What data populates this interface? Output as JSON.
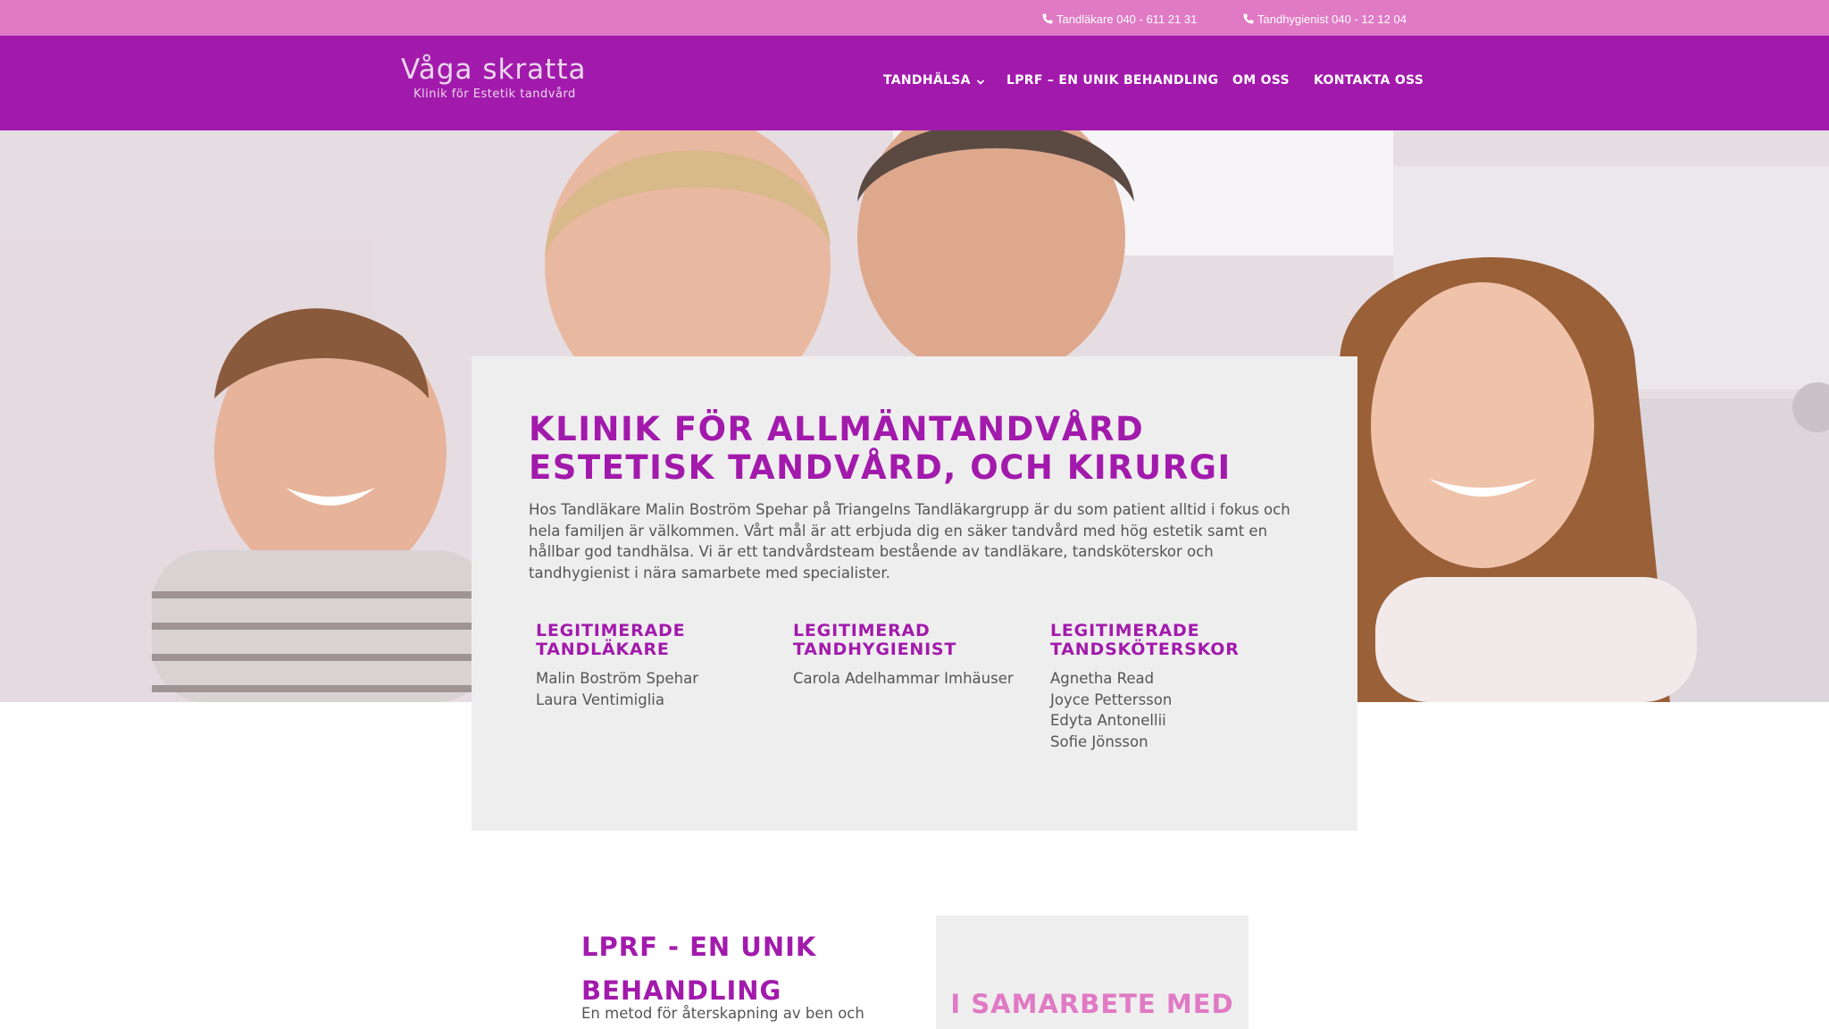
{
  "topbar": {
    "contacts": [
      {
        "icon": "phone-icon",
        "label": "Tandläkare 040 - 611 21 31"
      },
      {
        "icon": "phone-icon",
        "label": "Tandhygienist 040 - 12 12 04"
      }
    ],
    "background": "#e07ac4"
  },
  "header": {
    "background": "#a21aac",
    "logo": {
      "main": "Våga skratta",
      "sub": "Klinik för Estetik tandvård"
    },
    "nav": [
      {
        "label": "TANDHÄLSA",
        "icon": "chevron-down-icon"
      },
      {
        "label": "LPRF – EN UNIK BEHANDLING"
      },
      {
        "label": "OM OSS"
      },
      {
        "label": "KONTAKTA OSS"
      }
    ]
  },
  "card": {
    "title": "KLINIK FÖR ALLMÄNTANDVÅRD ESTETISK TANDVÅRD, OCH KIRURGI",
    "intro": "Hos Tandläkare Malin Boström Spehar på Triangelns Tandläkargrupp är du som patient alltid i fokus och hela familjen är välkommen. Vårt mål är att erbjuda dig en säker tandvård med hög estetik samt en hållbar god tandhälsa. Vi är ett tandvårdsteam bestående av tandläkare, tandsköterskor och tandhygienist i nära samarbete med specialister.",
    "staff": [
      {
        "heading": "LEGITIMERADE TANDLÄKARE",
        "names": [
          "Malin Boström Spehar",
          "Laura Ventimiglia"
        ]
      },
      {
        "heading": "LEGITIMERAD TANDHYGIENIST",
        "names": [
          "Carola Adelhammar Imhäuser"
        ]
      },
      {
        "heading": "LEGITIMERADE TANDSKÖTERSKOR",
        "names": [
          "Agnetha Read",
          "Joyce Pettersson",
          "Edyta Antonellii",
          "Sofie Jönsson"
        ]
      }
    ]
  },
  "lprf": {
    "title": "LPRF - EN UNIK BEHANDLING",
    "text": "En metod för återskapning av ben och"
  },
  "partner": {
    "title": "I SAMARBETE MED"
  },
  "colors": {
    "accent": "#a21aac",
    "pink": "#e07ac4",
    "card": "#efeeef"
  }
}
